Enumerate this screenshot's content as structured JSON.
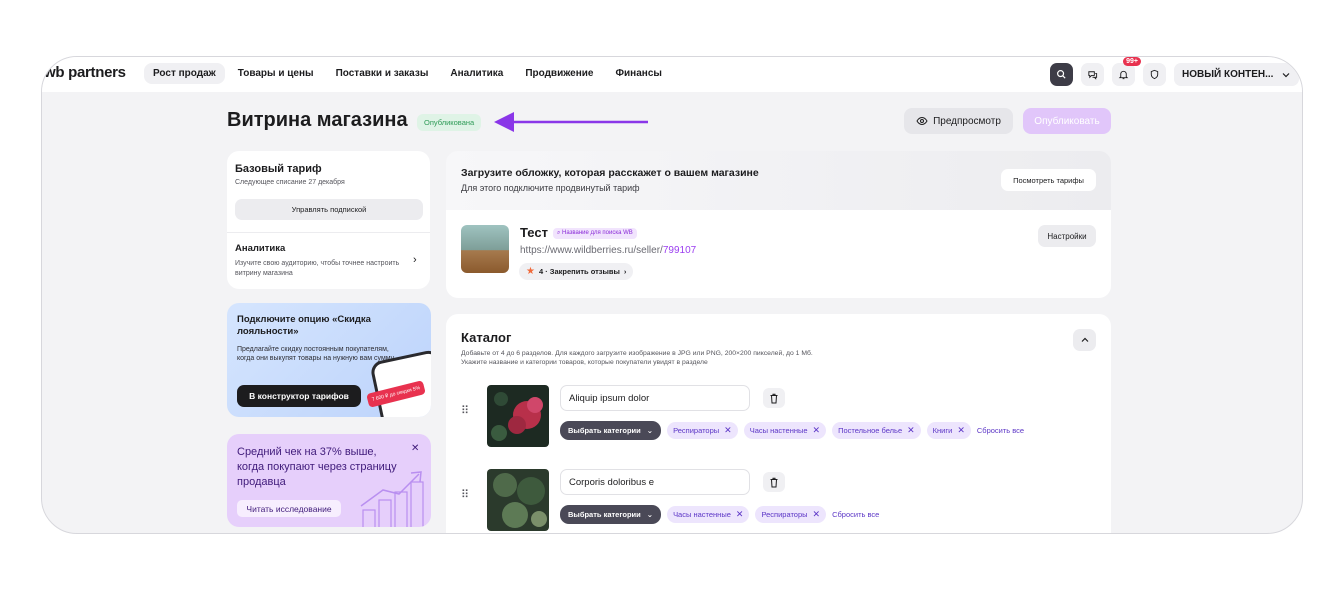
{
  "topbar": {
    "logo_prefix": "wb",
    "logo_text": " partners",
    "nav": [
      "Рост продаж",
      "Товары и цены",
      "Поставки и заказы",
      "Аналитика",
      "Продвижение",
      "Финансы"
    ],
    "notifications_badge": "99+",
    "account_name": "НОВЫЙ КОНТЕН..."
  },
  "header": {
    "title": "Витрина магазина",
    "status": "Опубликована",
    "preview_label": "Предпросмотр",
    "publish_label": "Опубликовать"
  },
  "sidebar": {
    "tariff_title": "Базовый тариф",
    "tariff_next_charge": "Следующее списание 27 декабря",
    "manage_subscription": "Управлять подпиской",
    "analytics_title": "Аналитика",
    "analytics_desc": "Изучите свою аудиторию, чтобы точнее настроить витрину магазина",
    "loyalty_title": "Подключите опцию «Скидка лояльности»",
    "loyalty_desc": "Предлагайте скидку постоянным покупателям, когда они выкупят товары на нужную вам сумму",
    "loyalty_button": "В конструктор тарифов",
    "loyalty_phone_tag": "7 600 ₽ до скидки 5%",
    "promo_text": "Средний чек на 37% выше, когда покупают через страницу продавца",
    "promo_button": "Читать исследование"
  },
  "cover": {
    "title": "Загрузите обложку, которая расскажет о вашем магазине",
    "subtitle": "Для этого подключите продвинутый тариф",
    "tariffs_button": "Посмотреть тарифы"
  },
  "store": {
    "name": "Тест",
    "search_tag": "Название для поиска WB",
    "url_prefix": "https://www.wildberries.ru/seller/",
    "url_id": "799107",
    "rating": "4 · Закрепить отзывы",
    "settings_button": "Настройки"
  },
  "catalog": {
    "title": "Каталог",
    "desc_line1": "Добавьте от 4 до 6 разделов. Для каждого загрузите изображение в JPG или PNG, 200×200 пикселей, до 1 Мб.",
    "desc_line2": "Укажите название и категории товаров, которые покупатели увидят в разделе",
    "choose_label": "Выбрать категории",
    "reset_label": "Сбросить все",
    "sections": [
      {
        "name": "Aliquip ipsum dolor",
        "categories": [
          "Респираторы",
          "Часы настенные",
          "Постельное белье",
          "Книги"
        ]
      },
      {
        "name": "Corporis doloribus e",
        "categories": [
          "Часы настенные",
          "Респираторы"
        ]
      }
    ]
  },
  "colors": {
    "accent": "#9b3ef0",
    "arrow": "#8a36e8",
    "published_green": "#2f9b57"
  }
}
